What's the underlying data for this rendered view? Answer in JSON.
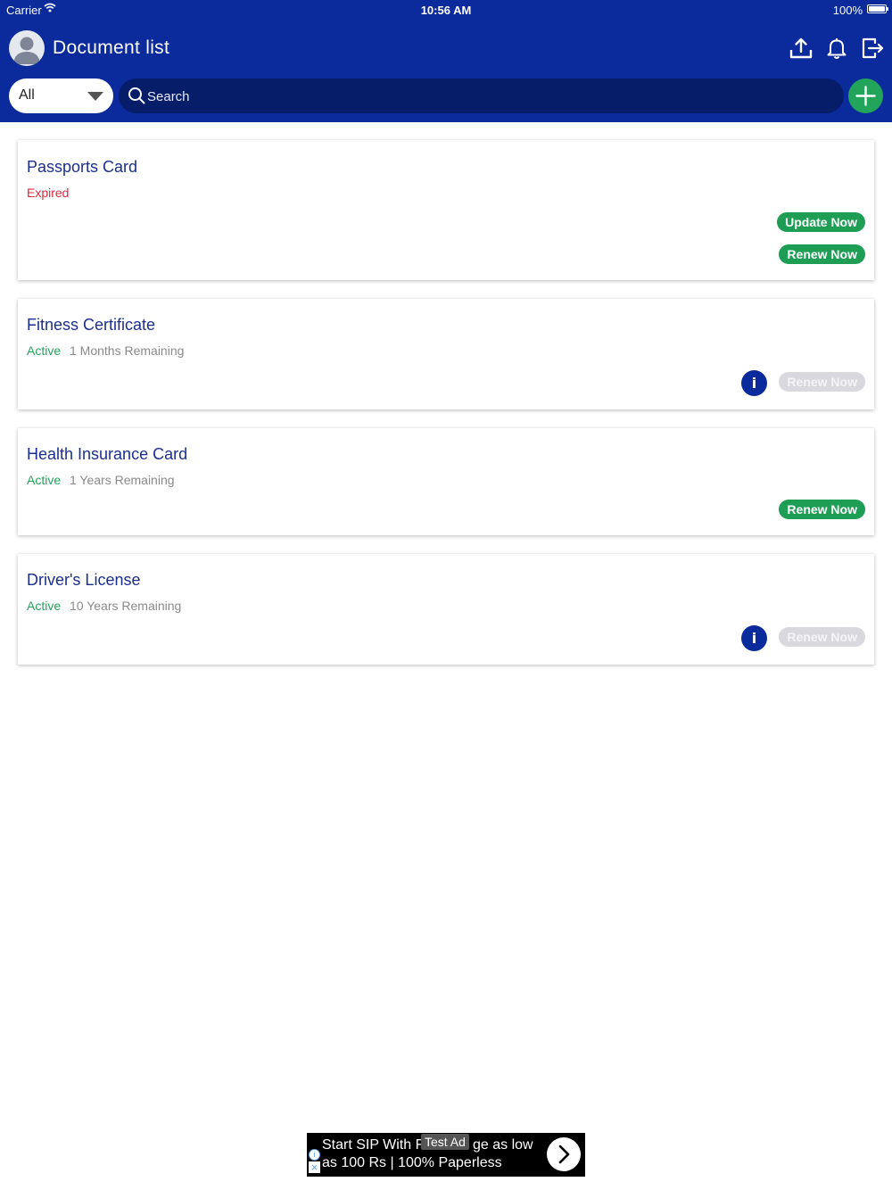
{
  "status_bar": {
    "carrier": "Carrier",
    "time": "10:56 AM",
    "battery": "100%"
  },
  "header": {
    "title": "Document list",
    "filter": {
      "selected": "All"
    },
    "search": {
      "placeholder": "Search"
    }
  },
  "colors": {
    "header_bg": "#0b2a9c",
    "accent_green": "#1e9e55",
    "expired_red": "#e0283a",
    "active_green": "#22a45a"
  },
  "documents": [
    {
      "title": "Passports Card",
      "status": "Expired",
      "remaining": "",
      "primary_action": "Update Now",
      "renew_label": "Renew Now",
      "renew_enabled": true
    },
    {
      "title": "Fitness Certificate",
      "status": "Active",
      "remaining": "1 Months Remaining",
      "renew_label": "Renew Now",
      "renew_enabled": false
    },
    {
      "title": "Health Insurance Card",
      "status": "Active",
      "remaining": "1 Years Remaining",
      "renew_label": "Renew Now",
      "renew_enabled": true
    },
    {
      "title": "Driver's License",
      "status": "Active",
      "remaining": "10 Years Remaining",
      "renew_label": "Renew Now",
      "renew_enabled": false
    }
  ],
  "info_label": "i",
  "ad": {
    "line1_left": "Start SIP With F",
    "badge": "Test Ad",
    "line1_right": "ge as low",
    "line2": "as 100 Rs | 100% Paperless"
  }
}
